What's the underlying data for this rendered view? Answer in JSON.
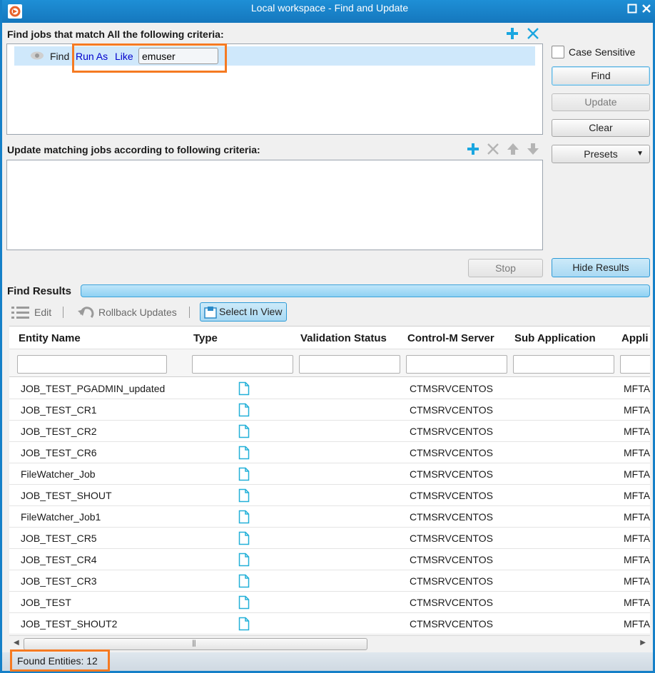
{
  "window": {
    "title": "Local workspace - Find and Update"
  },
  "find_section": {
    "label": "Find jobs that match All the following criteria:",
    "criterion": {
      "prefix": "Find",
      "field": "Run As",
      "operator": "Like",
      "value": "emuser"
    }
  },
  "update_section": {
    "label": "Update matching jobs according to following criteria:"
  },
  "side_panel": {
    "case_sensitive": "Case Sensitive",
    "find": "Find",
    "update": "Update",
    "clear": "Clear",
    "presets": "Presets"
  },
  "actions": {
    "stop": "Stop",
    "hide_results": "Hide Results"
  },
  "results": {
    "label": "Find Results",
    "toolbar": {
      "edit": "Edit",
      "rollback": "Rollback Updates",
      "select_in_view": "Select In View"
    },
    "columns": [
      "Entity Name",
      "Type",
      "Validation Status",
      "Control-M Server",
      "Sub Application",
      "Appli"
    ],
    "rows": [
      {
        "name": "JOB_TEST_PGADMIN_updated",
        "server": "CTMSRVCENTOS",
        "app": "MFTA"
      },
      {
        "name": "JOB_TEST_CR1",
        "server": "CTMSRVCENTOS",
        "app": "MFTA"
      },
      {
        "name": "JOB_TEST_CR2",
        "server": "CTMSRVCENTOS",
        "app": "MFTA"
      },
      {
        "name": "JOB_TEST_CR6",
        "server": "CTMSRVCENTOS",
        "app": "MFTA"
      },
      {
        "name": "FileWatcher_Job",
        "server": "CTMSRVCENTOS",
        "app": "MFTA"
      },
      {
        "name": "JOB_TEST_SHOUT",
        "server": "CTMSRVCENTOS",
        "app": "MFTA"
      },
      {
        "name": "FileWatcher_Job1",
        "server": "CTMSRVCENTOS",
        "app": "MFTA"
      },
      {
        "name": "JOB_TEST_CR5",
        "server": "CTMSRVCENTOS",
        "app": "MFTA"
      },
      {
        "name": "JOB_TEST_CR4",
        "server": "CTMSRVCENTOS",
        "app": "MFTA"
      },
      {
        "name": "JOB_TEST_CR3",
        "server": "CTMSRVCENTOS",
        "app": "MFTA"
      },
      {
        "name": "JOB_TEST",
        "server": "CTMSRVCENTOS",
        "app": "MFTA"
      },
      {
        "name": "JOB_TEST_SHOUT2",
        "server": "CTMSRVCENTOS",
        "app": "MFTA"
      }
    ]
  },
  "status": {
    "found_entities": "Found Entities: 12"
  },
  "colors": {
    "accent": "#1e8fd6",
    "link": "#0000cc",
    "highlight": "#f57a22"
  }
}
